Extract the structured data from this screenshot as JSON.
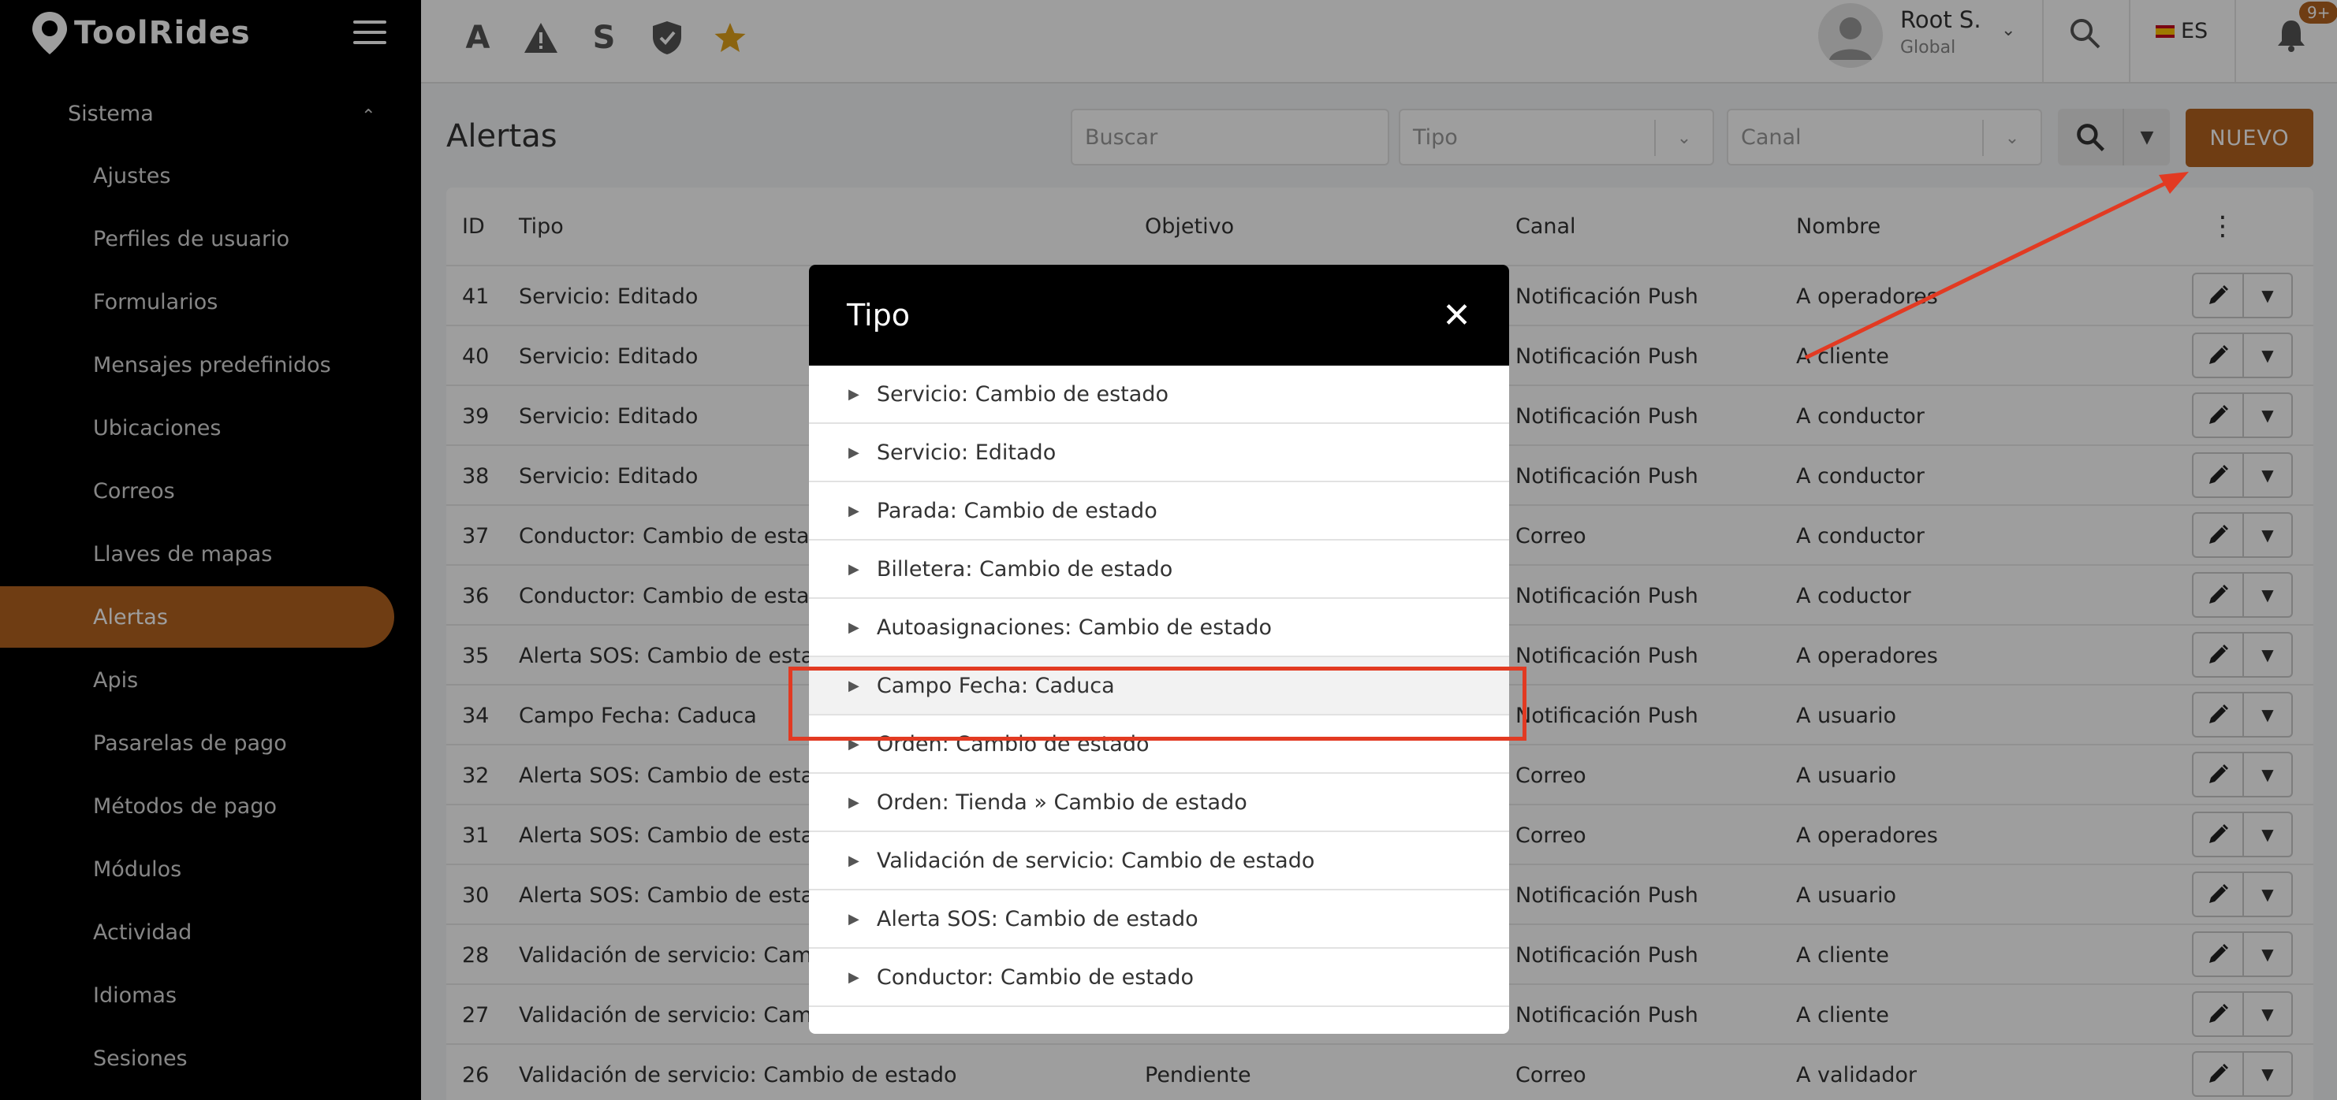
{
  "app": {
    "brand": "ToolRides"
  },
  "sidebar": {
    "section": "Sistema",
    "items": [
      {
        "label": "Ajustes"
      },
      {
        "label": "Perfiles de usuario"
      },
      {
        "label": "Formularios"
      },
      {
        "label": "Mensajes predefinidos"
      },
      {
        "label": "Ubicaciones"
      },
      {
        "label": "Correos"
      },
      {
        "label": "Llaves de mapas"
      },
      {
        "label": "Alertas",
        "active": true
      },
      {
        "label": "Apis"
      },
      {
        "label": "Pasarelas de pago"
      },
      {
        "label": "Métodos de pago"
      },
      {
        "label": "Módulos"
      },
      {
        "label": "Actividad"
      },
      {
        "label": "Idiomas"
      },
      {
        "label": "Sesiones"
      }
    ]
  },
  "header": {
    "letters": [
      "A",
      "S"
    ],
    "user": {
      "name": "Root S.",
      "role": "Global"
    },
    "language": "ES",
    "notifications": "9+"
  },
  "page": {
    "title": "Alertas",
    "search_placeholder": "Buscar",
    "type_placeholder": "Tipo",
    "channel_placeholder": "Canal",
    "new_label": "NUEVO"
  },
  "table": {
    "columns": [
      "ID",
      "Tipo",
      "Objetivo",
      "Canal",
      "Nombre"
    ],
    "rows": [
      {
        "id": "41",
        "tipo": "Servicio: Editado",
        "objetivo": "",
        "canal": "Notificación Push",
        "nombre": "A operadores"
      },
      {
        "id": "40",
        "tipo": "Servicio: Editado",
        "objetivo": "",
        "canal": "Notificación Push",
        "nombre": "A cliente"
      },
      {
        "id": "39",
        "tipo": "Servicio: Editado",
        "objetivo": "",
        "canal": "Notificación Push",
        "nombre": "A conductor"
      },
      {
        "id": "38",
        "tipo": "Servicio: Editado",
        "objetivo": "",
        "canal": "Notificación Push",
        "nombre": "A conductor"
      },
      {
        "id": "37",
        "tipo": "Conductor: Cambio de estad",
        "objetivo": "",
        "canal": "Correo",
        "nombre": "A conductor"
      },
      {
        "id": "36",
        "tipo": "Conductor: Cambio de estad",
        "objetivo": "",
        "canal": "Notificación Push",
        "nombre": "A coductor"
      },
      {
        "id": "35",
        "tipo": "Alerta SOS: Cambio de estac",
        "objetivo": "",
        "canal": "Notificación Push",
        "nombre": "A operadores"
      },
      {
        "id": "34",
        "tipo": "Campo Fecha: Caduca",
        "objetivo": "",
        "canal": "Notificación Push",
        "nombre": "A usuario"
      },
      {
        "id": "32",
        "tipo": "Alerta SOS: Cambio de estac",
        "objetivo": "",
        "canal": "Correo",
        "nombre": "A usuario"
      },
      {
        "id": "31",
        "tipo": "Alerta SOS: Cambio de estac",
        "objetivo": "",
        "canal": "Correo",
        "nombre": "A operadores"
      },
      {
        "id": "30",
        "tipo": "Alerta SOS: Cambio de estac",
        "objetivo": "",
        "canal": "Notificación Push",
        "nombre": "A usuario"
      },
      {
        "id": "28",
        "tipo": "Validación de servicio: Camb",
        "objetivo": "",
        "canal": "Notificación Push",
        "nombre": "A cliente"
      },
      {
        "id": "27",
        "tipo": "Validación de servicio: Camb",
        "objetivo": "",
        "canal": "Notificación Push",
        "nombre": "A cliente"
      },
      {
        "id": "26",
        "tipo": "Validación de servicio: Cambio de estado",
        "objetivo": "Pendiente",
        "canal": "Correo",
        "nombre": "A validador"
      }
    ]
  },
  "modal": {
    "title": "Tipo",
    "options": [
      "Servicio: Cambio de estado",
      "Servicio: Editado",
      "Parada: Cambio de estado",
      "Billetera: Cambio de estado",
      "Autoasignaciones: Cambio de estado",
      "Campo Fecha: Caduca",
      "Orden: Cambio de estado",
      "Orden: Tienda » Cambio de estado",
      "Validación de servicio: Cambio de estado",
      "Alerta SOS: Cambio de estado",
      "Conductor: Cambio de estado"
    ],
    "highlighted_option": "Campo Fecha: Caduca"
  },
  "colors": {
    "accent": "#b46320",
    "annotation": "#e23a22",
    "sidebar_bg": "#000000"
  }
}
